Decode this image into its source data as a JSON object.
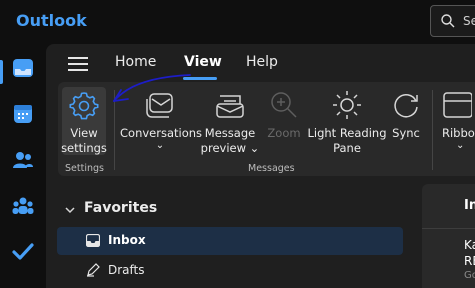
{
  "app": {
    "title": "Outlook"
  },
  "search": {
    "placeholder": "Se"
  },
  "tabs": [
    {
      "label": "Home",
      "active": false
    },
    {
      "label": "View",
      "active": true
    },
    {
      "label": "Help",
      "active": false
    }
  ],
  "ribbon": {
    "settings_group": {
      "label": "Settings",
      "view_settings": {
        "line1": "View",
        "line2": "settings",
        "icon": "gear-icon"
      }
    },
    "messages_group": {
      "label": "Messages",
      "conversations": {
        "label": "Conversations",
        "icon": "conversation-icon"
      },
      "message_preview": {
        "line1": "Message",
        "line2": "preview",
        "icon": "message-preview-icon"
      },
      "zoom": {
        "label": "Zoom",
        "icon": "zoom-in-icon",
        "disabled": true
      },
      "light_reading_pane": {
        "line1": "Light Reading",
        "line2": "Pane",
        "icon": "sun-icon"
      },
      "sync": {
        "label": "Sync",
        "icon": "sync-icon"
      }
    },
    "ribbon_button": {
      "label": "Ribbo",
      "icon": "ribbon-icon"
    }
  },
  "folders": {
    "favorites_label": "Favorites",
    "items": [
      {
        "label": "Inbox",
        "icon": "inbox-icon",
        "selected": true
      },
      {
        "label": "Drafts",
        "icon": "drafts-icon",
        "selected": false
      }
    ]
  },
  "reading_pane": {
    "header": "In",
    "line1": "Ka",
    "line2": "RE",
    "line3": "Go"
  },
  "colors": {
    "accent": "#479ef5",
    "selection": "#1d2f46",
    "annotation": "#1d1dc8"
  }
}
